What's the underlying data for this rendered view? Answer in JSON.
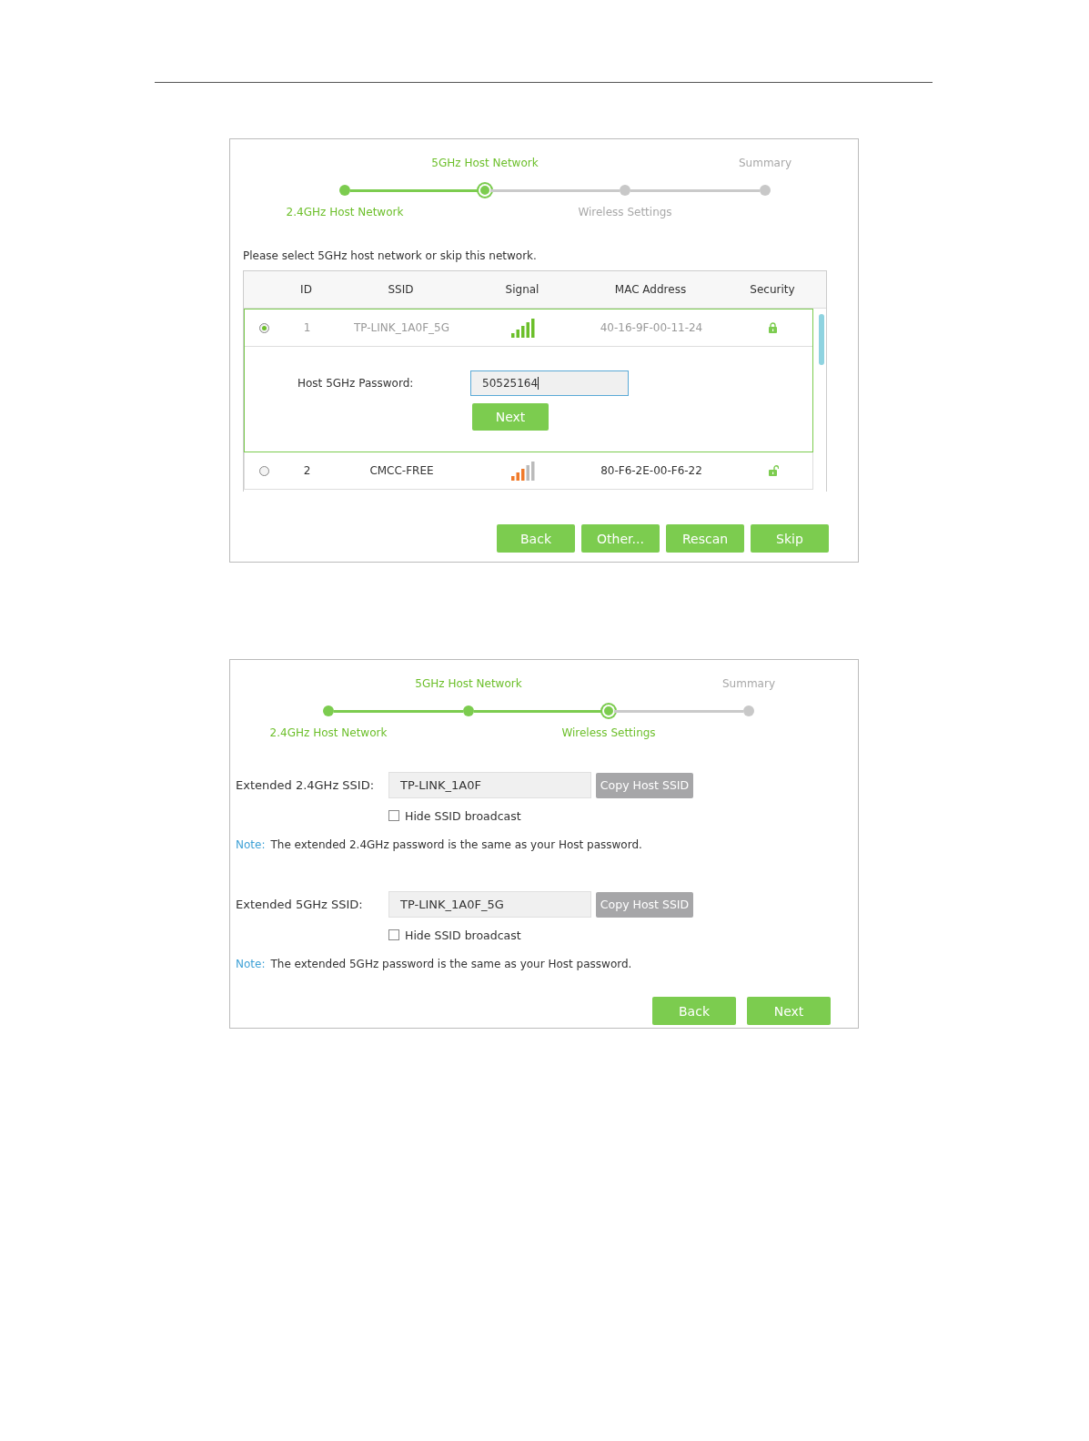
{
  "panels": [
    {
      "kind": "network_select",
      "steps": [
        {
          "label": "2.4GHz Host Network",
          "done": true,
          "current": false
        },
        {
          "label": "5GHz Host Network",
          "done": false,
          "current": true
        },
        {
          "label": "Wireless Settings",
          "done": false,
          "current": false
        },
        {
          "label": "Summary",
          "done": false,
          "current": false
        }
      ],
      "instruction": "Please select 5GHz host network or skip this network.",
      "table": {
        "columns": [
          "ID",
          "SSID",
          "Signal",
          "MAC Address",
          "Security"
        ],
        "rows": [
          {
            "selected": true,
            "id": "1",
            "ssid": "TP-LINK_1A0F_5G",
            "strong_signal": true,
            "mac": "40-16-9F-00-11-24",
            "locked": true,
            "password_form": {
              "label": "Host 5GHz Password:",
              "value": "50525164",
              "focused": true,
              "button": "Next"
            }
          },
          {
            "selected": false,
            "id": "2",
            "ssid": "CMCC-FREE",
            "strong_signal": false,
            "mac": "80-F6-2E-00-F6-22",
            "locked": false
          }
        ]
      },
      "buttons": [
        "Back",
        "Other...",
        "Rescan",
        "Skip"
      ]
    },
    {
      "kind": "wireless_settings",
      "steps": [
        {
          "label": "2.4GHz Host Network",
          "done": true,
          "current": false
        },
        {
          "label": "5GHz Host Network",
          "done": true,
          "current": false
        },
        {
          "label": "Wireless Settings",
          "done": false,
          "current": true
        },
        {
          "label": "Summary",
          "done": false,
          "current": false
        }
      ],
      "ssid_settings": [
        {
          "label": "Extended 2.4GHz SSID:",
          "value": "TP-LINK_1A0F",
          "button": "Copy Host SSID",
          "checkbox": {
            "label": "Hide SSID broadcast",
            "checked": false
          },
          "note_label": "Note:",
          "note": "The extended 2.4GHz password is the same as your Host password."
        },
        {
          "label": "Extended 5GHz SSID:",
          "value": "TP-LINK_1A0F_5G",
          "button": "Copy Host SSID",
          "checkbox": {
            "label": "Hide SSID broadcast",
            "checked": false
          },
          "note_label": "Note:",
          "note": "The extended 5GHz password is the same as your Host password."
        }
      ],
      "buttons": [
        "Back",
        "Next"
      ]
    }
  ]
}
